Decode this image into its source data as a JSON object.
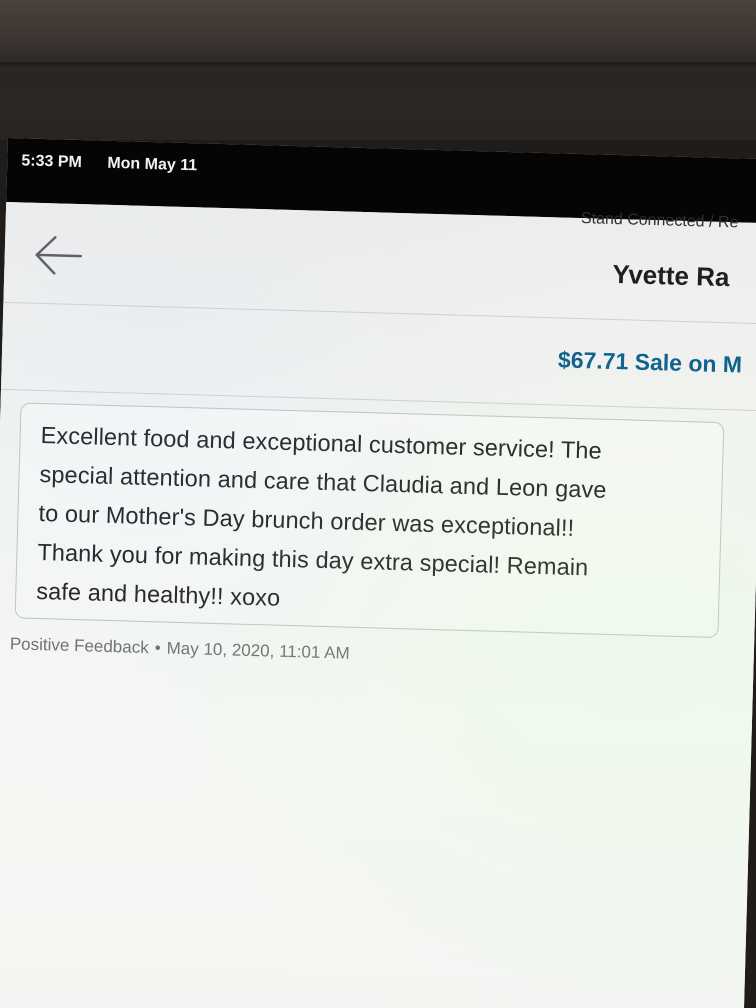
{
  "status_bar": {
    "time": "5:33 PM",
    "date": "Mon May 11"
  },
  "header": {
    "breadcrumb": "Stand Connected / Re",
    "customer_name": "Yvette Ra",
    "back_icon": "arrow-left-icon"
  },
  "sale": {
    "label": "$67.71 Sale on M"
  },
  "feedback": {
    "lines": [
      "Excellent food and exceptional customer service! The",
      "special attention and care that Claudia and Leon gave",
      "to our Mother's Day brunch order was exceptional!!",
      "Thank you for making this day extra special! Remain",
      "safe and healthy!! xoxo"
    ],
    "type": "Positive Feedback",
    "separator": "•",
    "timestamp": "May 10, 2020, 11:01 AM"
  },
  "colors": {
    "status_bar_bg": "#050505",
    "link_blue": "#0d5f8c",
    "meta_gray": "#6d6f6c"
  }
}
